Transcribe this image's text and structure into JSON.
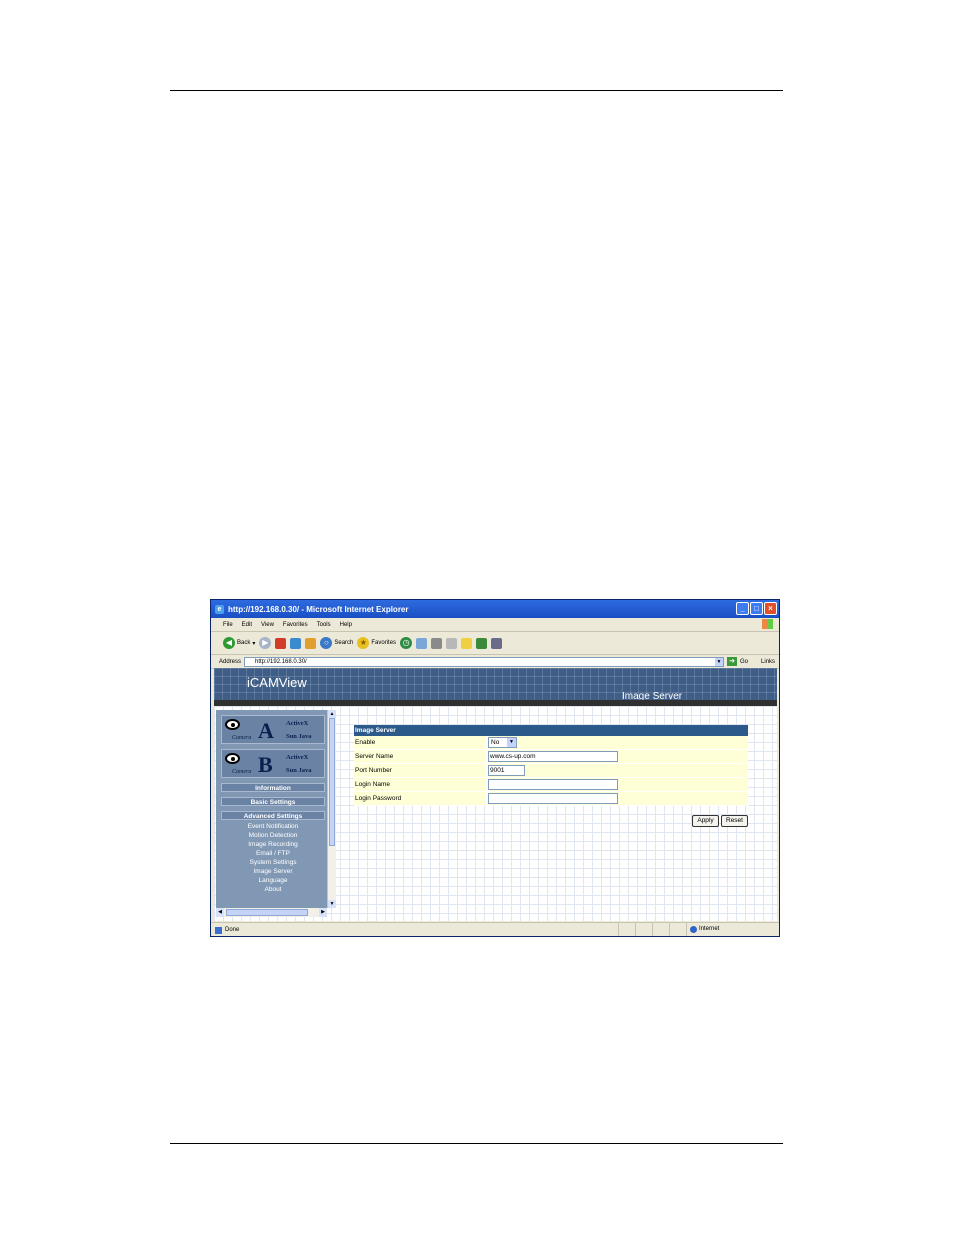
{
  "window": {
    "title": "http://192.168.0.30/ - Microsoft Internet Explorer"
  },
  "menubar": [
    "File",
    "Edit",
    "View",
    "Favorites",
    "Tools",
    "Help"
  ],
  "toolbar": {
    "back": "Back",
    "search": "Search",
    "favorites": "Favorites"
  },
  "addressbar": {
    "label": "Address",
    "url": "http://192.168.0.30/",
    "go": "Go",
    "links": "Links"
  },
  "app": {
    "brand": "iCAMView",
    "page_heading": "Image Server"
  },
  "sidebar": {
    "camera_a": {
      "letter": "A",
      "word": "Camera",
      "activex": "ActiveX",
      "java": "Sun Java"
    },
    "camera_b": {
      "letter": "B",
      "word": "Camera",
      "activex": "ActiveX",
      "java": "Sun Java"
    },
    "information": "Information",
    "basic_settings": "Basic Settings",
    "advanced_settings": "Advanced Settings",
    "advanced_items": [
      "Event Notification",
      "Motion Detection",
      "Image Recording",
      "Email / FTP",
      "System Settings",
      "Image Server"
    ],
    "language": "Language",
    "about": "About"
  },
  "form": {
    "title": "Image Server",
    "enable_label": "Enable",
    "enable_value": "No",
    "server_name_label": "Server Name",
    "server_name_value": "www.cs-up.com",
    "port_label": "Port Number",
    "port_value": "9001",
    "login_name_label": "Login Name",
    "login_name_value": "",
    "login_password_label": "Login Password",
    "login_password_value": "",
    "apply": "Apply",
    "reset": "Reset"
  },
  "statusbar": {
    "status": "Done",
    "zone": "Internet"
  }
}
